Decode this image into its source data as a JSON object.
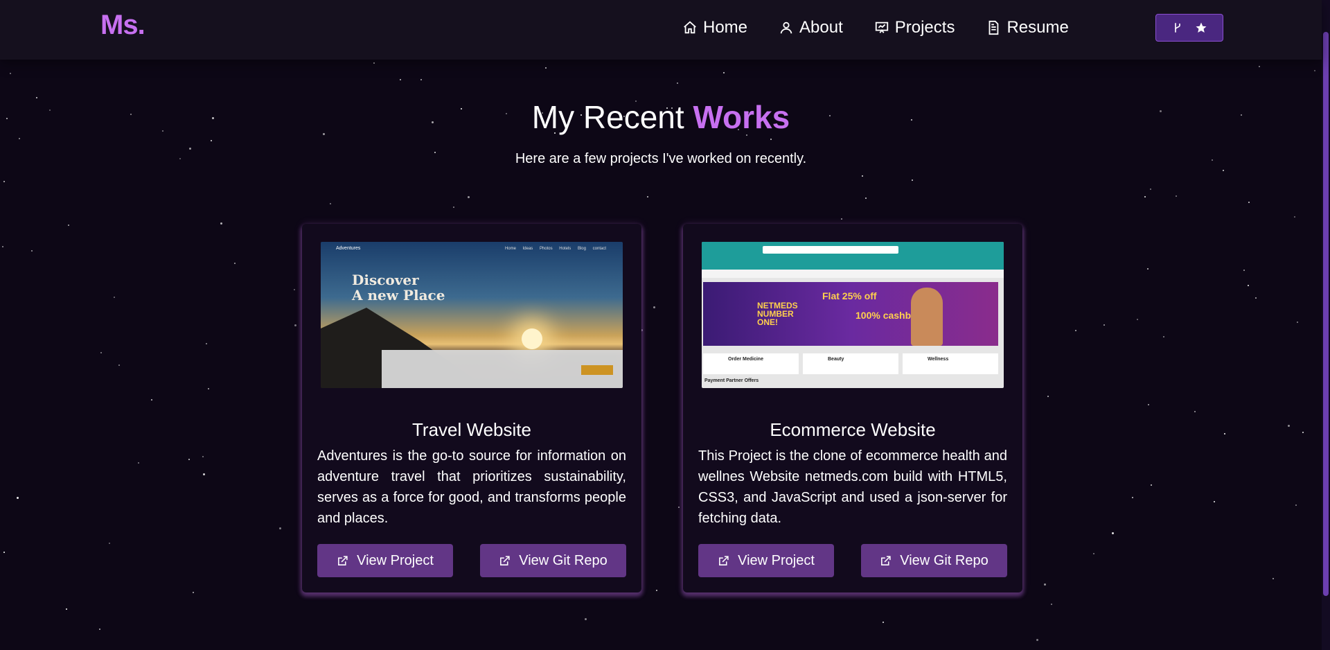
{
  "nav": {
    "logo": "Ms.",
    "links": [
      {
        "label": "Home",
        "icon": "home-icon"
      },
      {
        "label": "About",
        "icon": "user-icon"
      },
      {
        "label": "Projects",
        "icon": "presentation-icon"
      },
      {
        "label": "Resume",
        "icon": "document-icon"
      }
    ],
    "fork_button_icons": [
      "git-fork-icon",
      "star-icon"
    ]
  },
  "section": {
    "title_main": "My Recent",
    "title_accent": "Works",
    "subtitle": "Here are a few projects I've worked on recently."
  },
  "projects": [
    {
      "title": "Travel Website",
      "description": "Adventures is the go-to source for information on adventure travel that prioritizes sustainability, serves as a force for good, and transforms people and places.",
      "view_project": "View Project",
      "view_repo": "View Git Repo",
      "preview": {
        "brand": "Adventures",
        "menu": "Home Ideas Photos Hotels Blog contact",
        "hero": [
          "Discover",
          "A new Place"
        ]
      }
    },
    {
      "title": "Ecommerce Website",
      "description": "This Project is the clone of ecommerce health and wellnes Website netmeds.com build with HTML5, CSS3, and JavaScript and used a json-server for fetching data.",
      "view_project": "View Project",
      "view_repo": "View Git Repo",
      "preview": {
        "badge": "NETMEDS NUMBER ONE!",
        "offer": "Flat 25% off",
        "cashback": "100% cashback",
        "tiles": [
          "Order Medicine",
          "Beauty",
          "Wellness"
        ],
        "footer": "Payment Partner Offers"
      }
    }
  ],
  "colors": {
    "accent": "#c770f0",
    "button": "#623686",
    "background": "#0d0716",
    "navbar": "#15101e"
  }
}
